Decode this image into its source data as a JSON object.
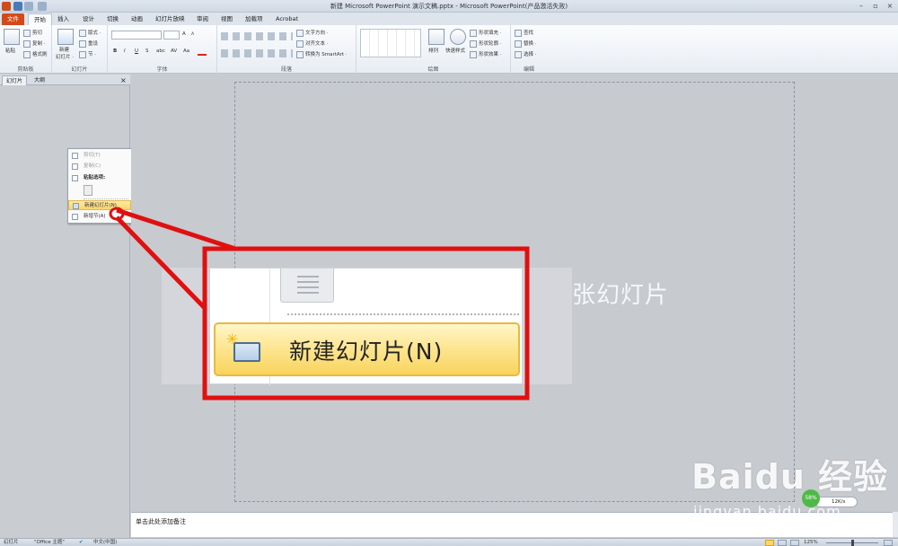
{
  "window": {
    "title": "新建 Microsoft PowerPoint 演示文稿.pptx - Microsoft PowerPoint(产品激活失败)"
  },
  "tabs": [
    {
      "label": "文件"
    },
    {
      "label": "开始"
    },
    {
      "label": "插入"
    },
    {
      "label": "设计"
    },
    {
      "label": "切换"
    },
    {
      "label": "动画"
    },
    {
      "label": "幻灯片放映"
    },
    {
      "label": "审阅"
    },
    {
      "label": "视图"
    },
    {
      "label": "加载项"
    },
    {
      "label": "Acrobat"
    }
  ],
  "ribbon": {
    "clipboard": {
      "paste": "粘贴",
      "cut": "剪切",
      "copy": "复制 ·",
      "format_painter": "格式刷",
      "group": "剪贴板"
    },
    "slides": {
      "new_slide": "新建",
      "new_slide2": "幻灯片 ·",
      "layout": "版式 ·",
      "reset": "重设",
      "section": "节 ·",
      "group": "幻灯片"
    },
    "font": {
      "group": "字体",
      "bold": "B",
      "italic": "I",
      "underline": "U",
      "strike": "S",
      "shadow": "abc",
      "spacing": "AV",
      "case": "Aa",
      "grow": "A",
      "shrink": "A"
    },
    "paragraph": {
      "text_direction": "文字方向 ·",
      "align_text": "对齐文本 ·",
      "convert_smartart": "转换为 SmartArt ·",
      "group": "段落"
    },
    "drawing": {
      "arrange": "排列",
      "quick_styles": "快速样式",
      "shape_fill": "形状填充 ·",
      "shape_outline": "形状轮廓 ·",
      "shape_effects": "形状效果 ·",
      "group": "绘图"
    },
    "editing": {
      "find": "查找",
      "replace": "替换 ·",
      "select": "选择 ·",
      "group": "编辑"
    }
  },
  "panel": {
    "tab_slides": "幻灯片",
    "tab_outline": "大纲",
    "close": "×"
  },
  "context_menu": {
    "cut": "剪切(T)",
    "copy": "复制(C)",
    "paste_options": "粘贴选项:",
    "new_slide": "新建幻灯片(N)",
    "new_section": "新增节(A)"
  },
  "zoom_callout": {
    "label": "新建幻灯片(N)"
  },
  "slide_text": "张幻灯片",
  "notes": {
    "placeholder": "单击此处添加备注"
  },
  "status": {
    "slide": "幻灯片",
    "theme": "\"Office 主题\"",
    "lang": "中文(中国)",
    "zoom": "125%"
  },
  "watermark": {
    "main": "Baidu 经验",
    "sub": "jingyan.baidu.com"
  },
  "speed": {
    "value": "12K/s",
    "pct": "58%"
  },
  "colors": {
    "accent": "#d04a1b",
    "highlight": "#fbd66a",
    "annotation": "#e01010"
  }
}
